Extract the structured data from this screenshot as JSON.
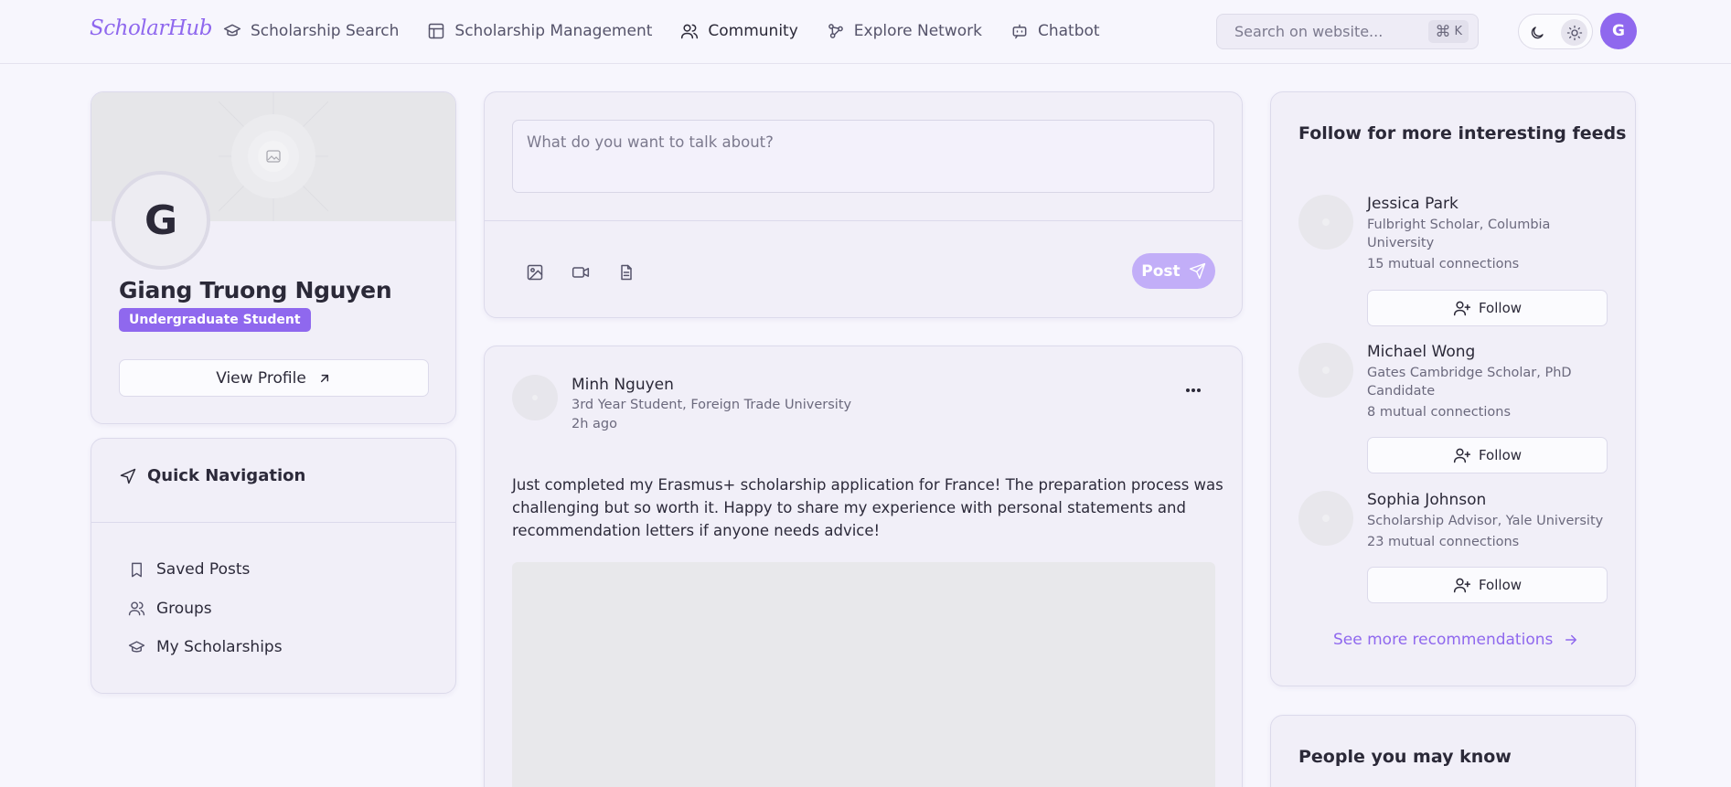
{
  "app": {
    "brand": "ScholarHub",
    "accent_color": "#8f68ee"
  },
  "nav": [
    {
      "label": "Scholarship Search",
      "icon": "graduation-cap-icon"
    },
    {
      "label": "Scholarship Management",
      "icon": "table-icon"
    },
    {
      "label": "Community",
      "icon": "users-icon",
      "active": true
    },
    {
      "label": "Explore Network",
      "icon": "network-icon"
    },
    {
      "label": "Chatbot",
      "icon": "bot-icon"
    }
  ],
  "search": {
    "placeholder": "Search on website...",
    "shortcut_symbol": "⌘",
    "shortcut_key": "K"
  },
  "user": {
    "initial": "G"
  },
  "profile": {
    "initial": "G",
    "name": "Giang Truong Nguyen",
    "role": "Undergraduate Student",
    "view_profile_label": "View Profile"
  },
  "quick_nav": {
    "title": "Quick Navigation",
    "items": [
      {
        "label": "Saved Posts",
        "icon": "bookmark-icon"
      },
      {
        "label": "Groups",
        "icon": "users-icon"
      },
      {
        "label": "My Scholarships",
        "icon": "graduation-cap-icon"
      }
    ]
  },
  "composer": {
    "placeholder": "What do you want to talk about?",
    "post_label": "Post"
  },
  "post": {
    "author": "Minh Nguyen",
    "subtitle": "3rd Year Student, Foreign Trade University",
    "time": "2h ago",
    "body": "Just completed my Erasmus+ scholarship application for France! The preparation process was challenging but so worth it. Happy to share my experience with personal statements and recommendation letters if anyone needs advice!"
  },
  "follow": {
    "title": "Follow for more interesting feeds",
    "button_label": "Follow",
    "suggestions": [
      {
        "name": "Jessica Park",
        "title": "Fulbright Scholar, Columbia University",
        "mutual": "15 mutual connections"
      },
      {
        "name": "Michael Wong",
        "title": "Gates Cambridge Scholar, PhD Candidate",
        "mutual": "8 mutual connections"
      },
      {
        "name": "Sophia Johnson",
        "title": "Scholarship Advisor, Yale University",
        "mutual": "23 mutual connections"
      }
    ],
    "see_more_label": "See more recommendations"
  },
  "people": {
    "title": "People you may know"
  }
}
